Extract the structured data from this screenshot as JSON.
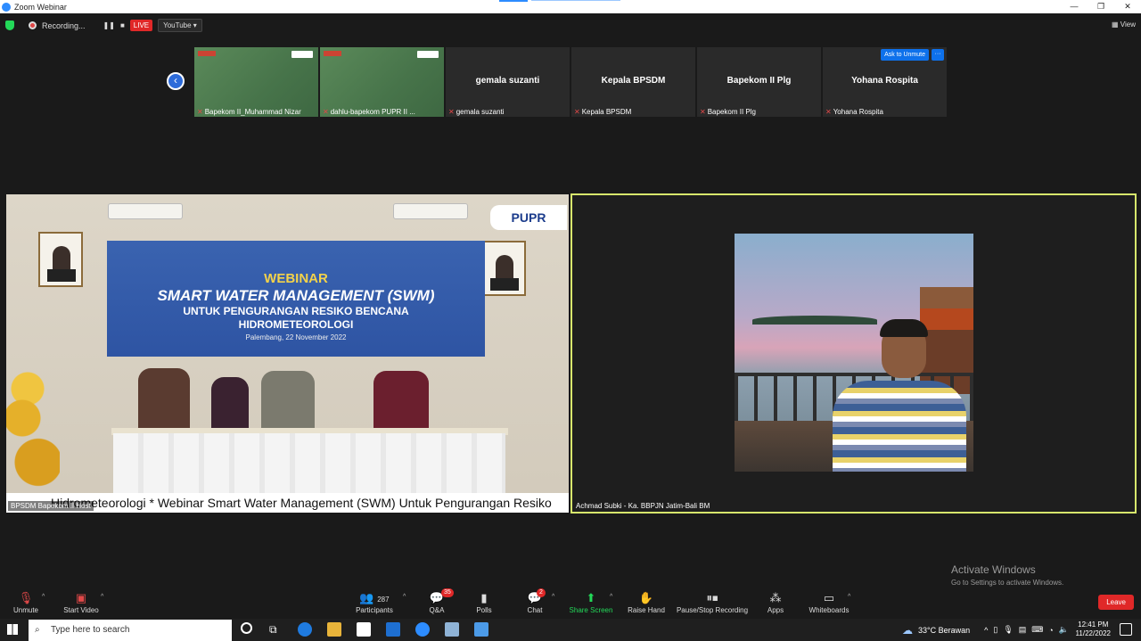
{
  "window": {
    "title": "Zoom Webinar",
    "controls": [
      "—",
      "❐",
      "✕"
    ]
  },
  "topbar": {
    "recording_label": "Recording...",
    "live_label": "LIVE",
    "stream_target": "YouTube",
    "view_label": "View"
  },
  "gallery": {
    "tiles": [
      {
        "type": "slide",
        "caption": "Bapekom II_Muhammad Nizar"
      },
      {
        "type": "slide",
        "caption": "dahlu-bapekom PUPR II ..."
      },
      {
        "type": "name",
        "name": "gemala suzanti",
        "caption": "gemala suzanti"
      },
      {
        "type": "name",
        "name": "Kepala BPSDM",
        "caption": "Kepala BPSDM"
      },
      {
        "type": "name",
        "name": "Bapekom II Plg",
        "caption": "Bapekom II Plg"
      },
      {
        "type": "name",
        "name": "Yohana Rospita",
        "caption": "Yohana Rospita"
      }
    ],
    "ask_to_unmute": "Ask to Unmute",
    "more_label": "···"
  },
  "main_video": {
    "banner": {
      "line1": "WEBINAR",
      "line2": "SMART WATER MANAGEMENT (SWM)",
      "line3": "UNTUK PENGURANGAN RESIKO BENCANA",
      "line4": "HIDROMETEOROLOGI",
      "line5": "Palembang, 22 November 2022"
    },
    "logo": "PUPR",
    "ticker": "Hidrometeorologi * Webinar Smart Water Management (SWM) Untuk Pengurangan Resiko",
    "label": "BPSDM Bapekom II Host"
  },
  "speaker": {
    "label": "Achmad Subki - Ka. BBPJN Jatim-Bali BM"
  },
  "watermark": {
    "title": "Activate Windows",
    "subtitle": "Go to Settings to activate Windows."
  },
  "toolbar": {
    "unmute": "Unmute",
    "start_video": "Start Video",
    "participants": "Participants",
    "participants_count": "287",
    "qa": "Q&A",
    "qa_badge": "35",
    "polls": "Polls",
    "chat": "Chat",
    "chat_badge": "2",
    "share_screen": "Share Screen",
    "raise_hand": "Raise Hand",
    "pause_recording": "Pause/Stop Recording",
    "apps": "Apps",
    "whiteboards": "Whiteboards",
    "leave": "Leave"
  },
  "taskbar": {
    "search_placeholder": "Type here to search",
    "weather": "33°C  Berawan",
    "time": "12:41 PM",
    "date": "11/22/2022"
  }
}
